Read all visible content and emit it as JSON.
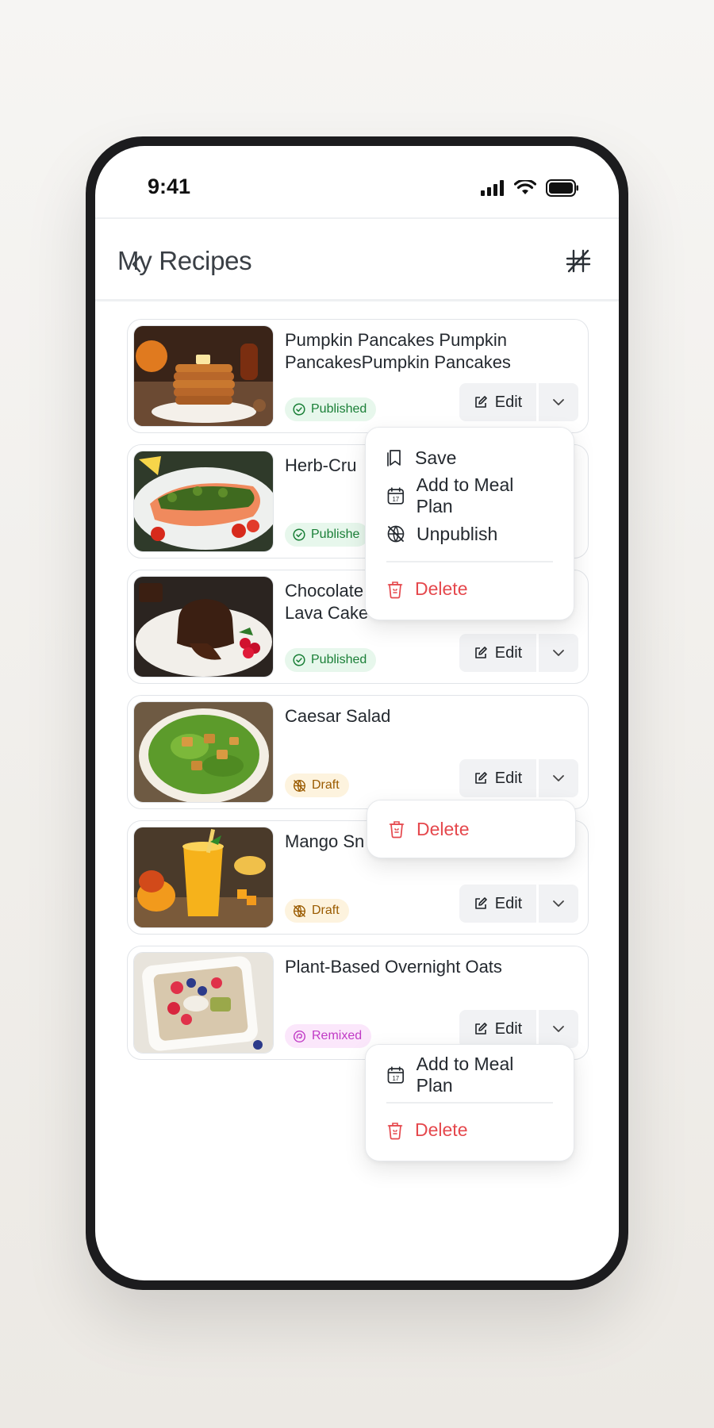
{
  "status_bar": {
    "time": "9:41"
  },
  "header": {
    "title": "My Recipes"
  },
  "recipes": [
    {
      "title": "Pumpkin Pancakes Pumpkin PancakesPumpkin Pancakes",
      "status": "Published"
    },
    {
      "title": "Herb-Cru",
      "status": "Publishe"
    },
    {
      "title": "Chocolate Lava Cake",
      "status": "Published"
    },
    {
      "title": "Caesar Salad",
      "status": "Draft"
    },
    {
      "title": "Mango Sn",
      "status": "Draft"
    },
    {
      "title": "Plant-Based Overnight Oats",
      "status": "Remixed"
    }
  ],
  "actions": {
    "edit": "Edit"
  },
  "menus": {
    "published": {
      "save": "Save",
      "meal_plan": "Add to Meal Plan",
      "unpublish": "Unpublish",
      "delete": "Delete"
    },
    "draft": {
      "delete": "Delete"
    },
    "remixed": {
      "meal_plan": "Add to Meal Plan",
      "delete": "Delete"
    }
  },
  "colors": {
    "published": "#1a7f37",
    "draft": "#9a5b00",
    "remixed": "#c03ac5",
    "danger": "#e5484d"
  },
  "icons": [
    "check-circle-icon",
    "globe-off-icon",
    "remix-icon",
    "edit-icon",
    "chevron-down-icon",
    "bookmark-icon",
    "calendar-icon",
    "trash-icon",
    "grid-toggle-icon"
  ]
}
